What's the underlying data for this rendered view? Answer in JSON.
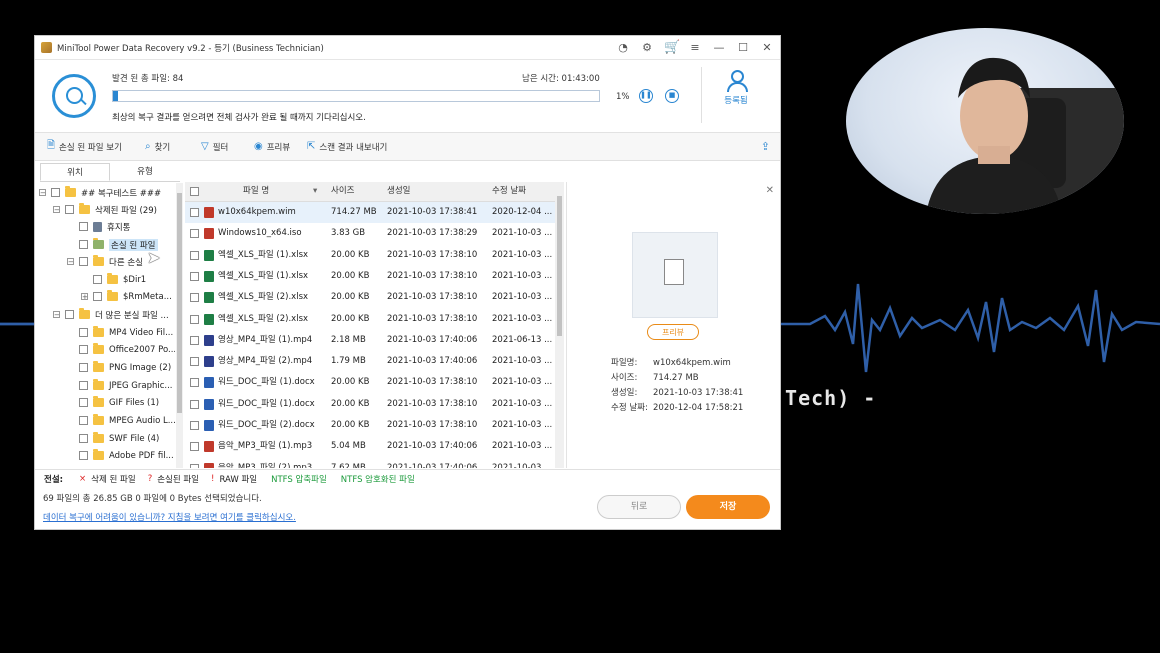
{
  "window": {
    "title": "MiniTool Power Data Recovery v9.2 - 등기 (Business Technician)"
  },
  "scan": {
    "found_label": "발견 된 총 파일: 84",
    "remaining_label": "남은 시간: 01:43:00",
    "percent": "1%",
    "progress_fraction": 0.01,
    "notice": "최상의 복구 결과를 얻으려면 전체 검사가 완료 될 때까지 기다리십시오.",
    "register_label": "등록됨"
  },
  "toolbar": {
    "show_lost": "손실 된 파일 보기",
    "find": "찾기",
    "filter": "필터",
    "preview": "프리뷰",
    "export": "스캔 결과 내보내기"
  },
  "tabs": {
    "location": "위치",
    "type": "유형"
  },
  "tree": [
    "## 복구테스트 ###",
    "삭제된 파일 (29)",
    "휴지통",
    "손실 된 파일",
    "다른 손실",
    "$Dir1",
    "$RmMeta...",
    "더 많은 분실 파일 ...",
    "MP4 Video Fil...",
    "Office2007 Po...",
    "PNG Image (2)",
    "JPEG Graphic...",
    "GIF Files (1)",
    "MPEG Audio L...",
    "SWF File (4)",
    "Adobe PDF fil..."
  ],
  "list": {
    "headers": [
      "파일 명",
      "사이즈",
      "생성일",
      "수정 날짜"
    ],
    "rows": [
      {
        "name": "w10x64kpem.wim",
        "size": "714.27 MB",
        "created": "2021-10-03 17:38:41",
        "modified": "2020-12-04 ..."
      },
      {
        "name": "Windows10_x64.iso",
        "size": "3.83 GB",
        "created": "2021-10-03 17:38:29",
        "modified": "2021-10-03 ..."
      },
      {
        "name": "엑셀_XLS_파일 (1).xlsx",
        "size": "20.00 KB",
        "created": "2021-10-03 17:38:10",
        "modified": "2021-10-03 ..."
      },
      {
        "name": "엑셀_XLS_파일 (1).xlsx",
        "size": "20.00 KB",
        "created": "2021-10-03 17:38:10",
        "modified": "2021-10-03 ..."
      },
      {
        "name": "엑셀_XLS_파일 (2).xlsx",
        "size": "20.00 KB",
        "created": "2021-10-03 17:38:10",
        "modified": "2021-10-03 ..."
      },
      {
        "name": "엑셀_XLS_파일 (2).xlsx",
        "size": "20.00 KB",
        "created": "2021-10-03 17:38:10",
        "modified": "2021-10-03 ..."
      },
      {
        "name": "영상_MP4_파일 (1).mp4",
        "size": "2.18 MB",
        "created": "2021-10-03 17:40:06",
        "modified": "2021-06-13 ..."
      },
      {
        "name": "영상_MP4_파일 (2).mp4",
        "size": "1.79 MB",
        "created": "2021-10-03 17:40:06",
        "modified": "2021-10-03 ..."
      },
      {
        "name": "워드_DOC_파일 (1).docx",
        "size": "20.00 KB",
        "created": "2021-10-03 17:38:10",
        "modified": "2021-10-03 ..."
      },
      {
        "name": "워드_DOC_파일 (1).docx",
        "size": "20.00 KB",
        "created": "2021-10-03 17:38:10",
        "modified": "2021-10-03 ..."
      },
      {
        "name": "워드_DOC_파일 (2).docx",
        "size": "20.00 KB",
        "created": "2021-10-03 17:38:10",
        "modified": "2021-10-03 ..."
      },
      {
        "name": "음악_MP3_파일 (1).mp3",
        "size": "5.04 MB",
        "created": "2021-10-03 17:40:06",
        "modified": "2021-10-03 ..."
      },
      {
        "name": "음악_MP3_파일 (2).mp3",
        "size": "7.62 MB",
        "created": "2021-10-03 17:40:06",
        "modified": "2021-10-03 ..."
      }
    ]
  },
  "preview": {
    "button": "프리뷰",
    "filename_label": "파일명:",
    "filename": "w10x64kpem.wim",
    "size_label": "사이즈:",
    "size": "714.27 MB",
    "created_label": "생성일:",
    "created": "2021-10-03 17:38:41",
    "modified_label": "수정 날짜:",
    "modified": "2020-12-04 17:58:21"
  },
  "legend": {
    "title": "전설:",
    "deleted": "삭제 된 파일",
    "lost": "손실된 파일",
    "raw": "RAW 파일",
    "ntfs_compressed": "NTFS 압축파일",
    "ntfs_encrypted": "NTFS 암호화된 파일"
  },
  "footer": {
    "status": "69 파일의 총 26.85 GB  0 파일에 0 Bytes 선택되었습니다.",
    "help": "데이터 복구에 어려움이 있습니까? 지침을 보려면 여기를 클릭하십시오.",
    "back": "뒤로",
    "save": "저장"
  },
  "overlay": {
    "tech_text": "(Tech) -"
  },
  "colors": {
    "accent": "#2a86d1",
    "save": "#f48a1c",
    "wave": "#2f5fa8"
  }
}
